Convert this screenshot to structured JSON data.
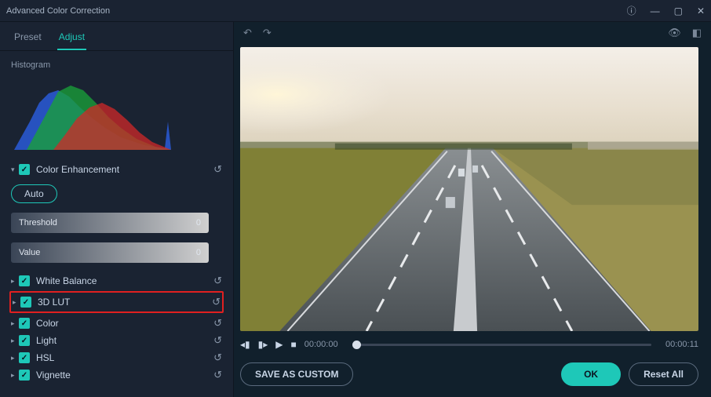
{
  "window": {
    "title": "Advanced Color Correction"
  },
  "tabs": {
    "preset": "Preset",
    "adjust": "Adjust"
  },
  "histogram_label": "Histogram",
  "sections": {
    "color_enhancement": "Color Enhancement",
    "white_balance": "White Balance",
    "lut": "3D LUT",
    "color": "Color",
    "light": "Light",
    "hsl": "HSL",
    "vignette": "Vignette"
  },
  "auto_label": "Auto",
  "sliders": {
    "threshold": {
      "label": "Threshold",
      "value": "0"
    },
    "value": {
      "label": "Value",
      "value": "0"
    }
  },
  "transport": {
    "current": "00:00:00",
    "total": "00:00:11"
  },
  "buttons": {
    "save_custom": "SAVE AS CUSTOM",
    "ok": "OK",
    "reset_all": "Reset All"
  }
}
